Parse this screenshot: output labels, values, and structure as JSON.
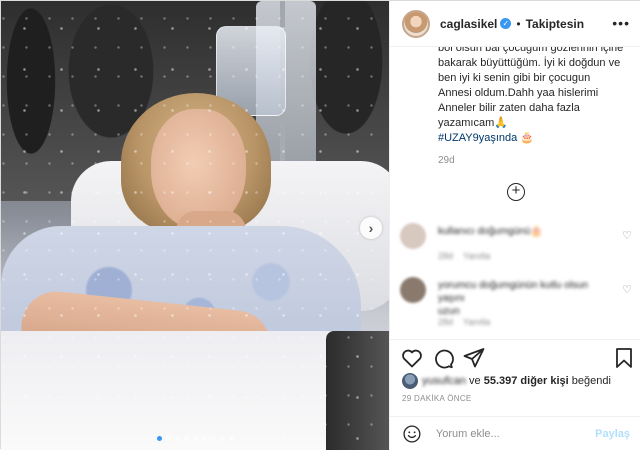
{
  "post": {
    "photo": {
      "carousel_dot_count": 9,
      "active_dot_index": 0,
      "next_icon": "chevron-right-icon"
    },
    "header": {
      "username": "caglasikel",
      "separator": "•",
      "follow_status": "Takiptesin",
      "more_icon": "ellipsis-icon"
    },
    "caption": {
      "partial_top_line": "bol olsun bal çocuğum gözlerinin içine",
      "lines": [
        "bakarak büyüttüğüm. İyi ki doğdun ve",
        "ben iyi ki senin gibi bir çocugun",
        "Annesi oldum.Dahh yaa hislerimi",
        "Anneler bilir zaten daha fazla",
        "yazamıcam🙏"
      ],
      "hashtag": "#UZAY9yaşında",
      "hashtag_emoji": "🎂",
      "time": "29d"
    },
    "load_more_icon": "plus-circle-icon",
    "comments": [
      {
        "text": "kullanıcı doğumgünü🎂",
        "time": "28d",
        "reply": "Yanıtla",
        "avatar_color": "#d7c8c0"
      },
      {
        "text": "yorumcu doğumgünün kutlu olsun yaşını",
        "text_line2": "uzun",
        "time": "28d",
        "reply": "Yanıtla",
        "avatar_color": "#8a7a6e"
      }
    ],
    "actions": {
      "like_icon": "heart-icon",
      "comment_icon": "comment-icon",
      "share_icon": "paper-plane-icon",
      "save_icon": "bookmark-icon"
    },
    "likes": {
      "blurred_name": "yusufcan",
      "connector": "ve",
      "count_text": "55.397 diğer kişi",
      "suffix": "beğendi"
    },
    "timestamp": "29 DAKİKA ÖNCE",
    "comment_box": {
      "emoji_icon": "smiley-icon",
      "placeholder": "Yorum ekle...",
      "post_label": "Paylaş"
    },
    "colors": {
      "link_blue": "#00376b",
      "verified_blue": "#3897f0",
      "disabled_post_blue": "#b2dffc",
      "muted_text": "#8e8e8e"
    }
  }
}
